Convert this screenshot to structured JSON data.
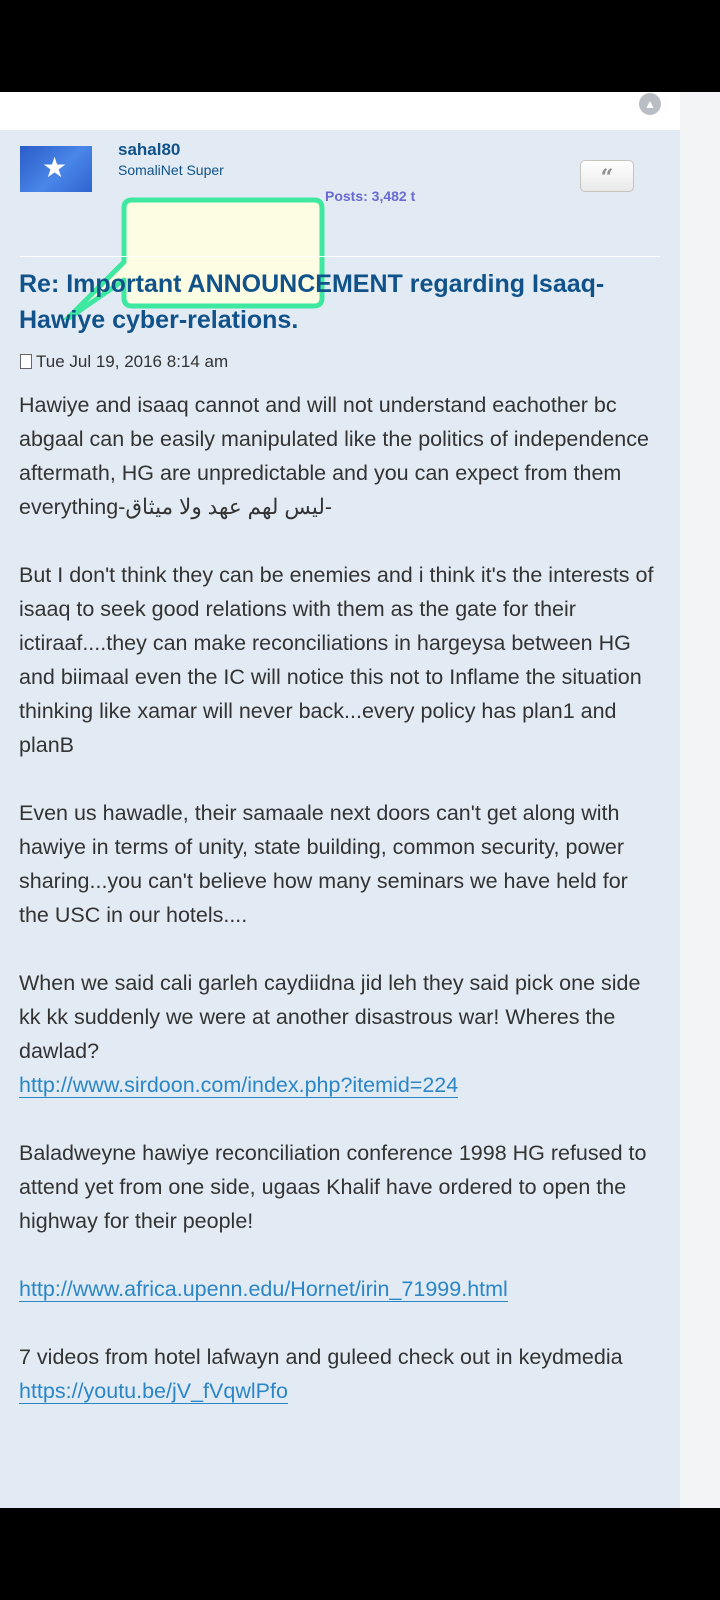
{
  "nav": {
    "top_icon": "up-arrow-icon"
  },
  "author": {
    "username": "sahal80",
    "rank": "SomaliNet Super",
    "link": "Posts: 3,482 t"
  },
  "post": {
    "quote_icon": "quote-icon",
    "title": "Re: Important ANNOUNCEMENT regarding Isaaq-Hawiye cyber-relations.",
    "date": "Tue Jul 19, 2016 8:14 am",
    "paragraphs": [
      "Hawiye and isaaq cannot and will not understand eachother bc abgaal can be easily manipulated like the politics of independence aftermath, HG are unpredictable and you can expect from them everything-ليس لهم عهد ولا ميثاق-",
      "But I don't think they can be enemies and i think it's the interests of isaaq to seek good relations with them as the gate for their ictiraaf....they can make reconciliations in hargeysa between HG and biimaal even the IC will notice this not to Inflame the situation thinking like xamar will never back...every policy has plan1 and planB",
      "Even us hawadle, their samaale next doors can't get along with hawiye in terms of unity, state building, common security, power sharing...you can't believe how many seminars we have held for the USC in our hotels....",
      "When we said cali garleh caydiidna jid leh they said pick one side kk kk suddenly we were at another disastrous war! Wheres the dawlad?"
    ],
    "link1": "http://www.sirdoon.com/index.php?itemid=224",
    "paragraph5": "Baladweyne hawiye reconciliation conference 1998 HG refused to attend yet from one side, ugaas Khalif have ordered to open the highway for their people!",
    "link2": "http://www.africa.upenn.edu/Hornet/irin_71999.html",
    "paragraph6": "7 videos from hotel lafwayn and guleed check out in keydmedia",
    "link3": "https://youtu.be/jV_fVqwlPfo"
  },
  "colors": {
    "post_bg": "#e2ebf3",
    "title": "#105289",
    "link": "#2b86c8",
    "callout_fill": "#fdfde3",
    "callout_border": "#3ee8a0"
  }
}
